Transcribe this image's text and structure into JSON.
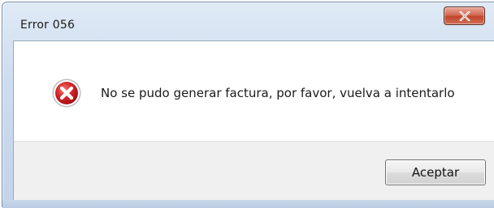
{
  "dialog": {
    "title": "Error 056",
    "message": "No se pudo generar factura, por favor, vuelva a intentarlo",
    "ok_label": "Aceptar",
    "icon": "error-icon",
    "close_icon": "close-icon"
  },
  "colors": {
    "error_red": "#c8161d",
    "close_button_red": "#c0432a",
    "title_bar": "#cddcee",
    "button_bar": "#f0f0f0"
  }
}
